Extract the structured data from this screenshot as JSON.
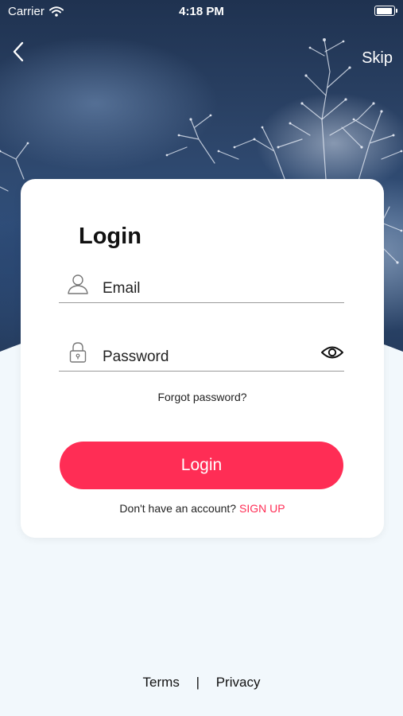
{
  "status_bar": {
    "carrier": "Carrier",
    "time": "4:18 PM"
  },
  "header": {
    "skip_label": "Skip"
  },
  "login_card": {
    "title": "Login",
    "email_placeholder": "Email",
    "password_placeholder": "Password",
    "forgot_password": "Forgot password?",
    "login_button": "Login",
    "no_account_text": "Don't have an account?",
    "sign_up_link": "SIGN UP"
  },
  "footer": {
    "terms": "Terms",
    "separator": "|",
    "privacy": "Privacy"
  },
  "colors": {
    "accent": "#ff2d55",
    "page_background": "#f2f8fc"
  },
  "icons": [
    "back-chevron-icon",
    "user-icon",
    "lock-icon",
    "eye-icon",
    "wifi-icon",
    "battery-icon"
  ]
}
